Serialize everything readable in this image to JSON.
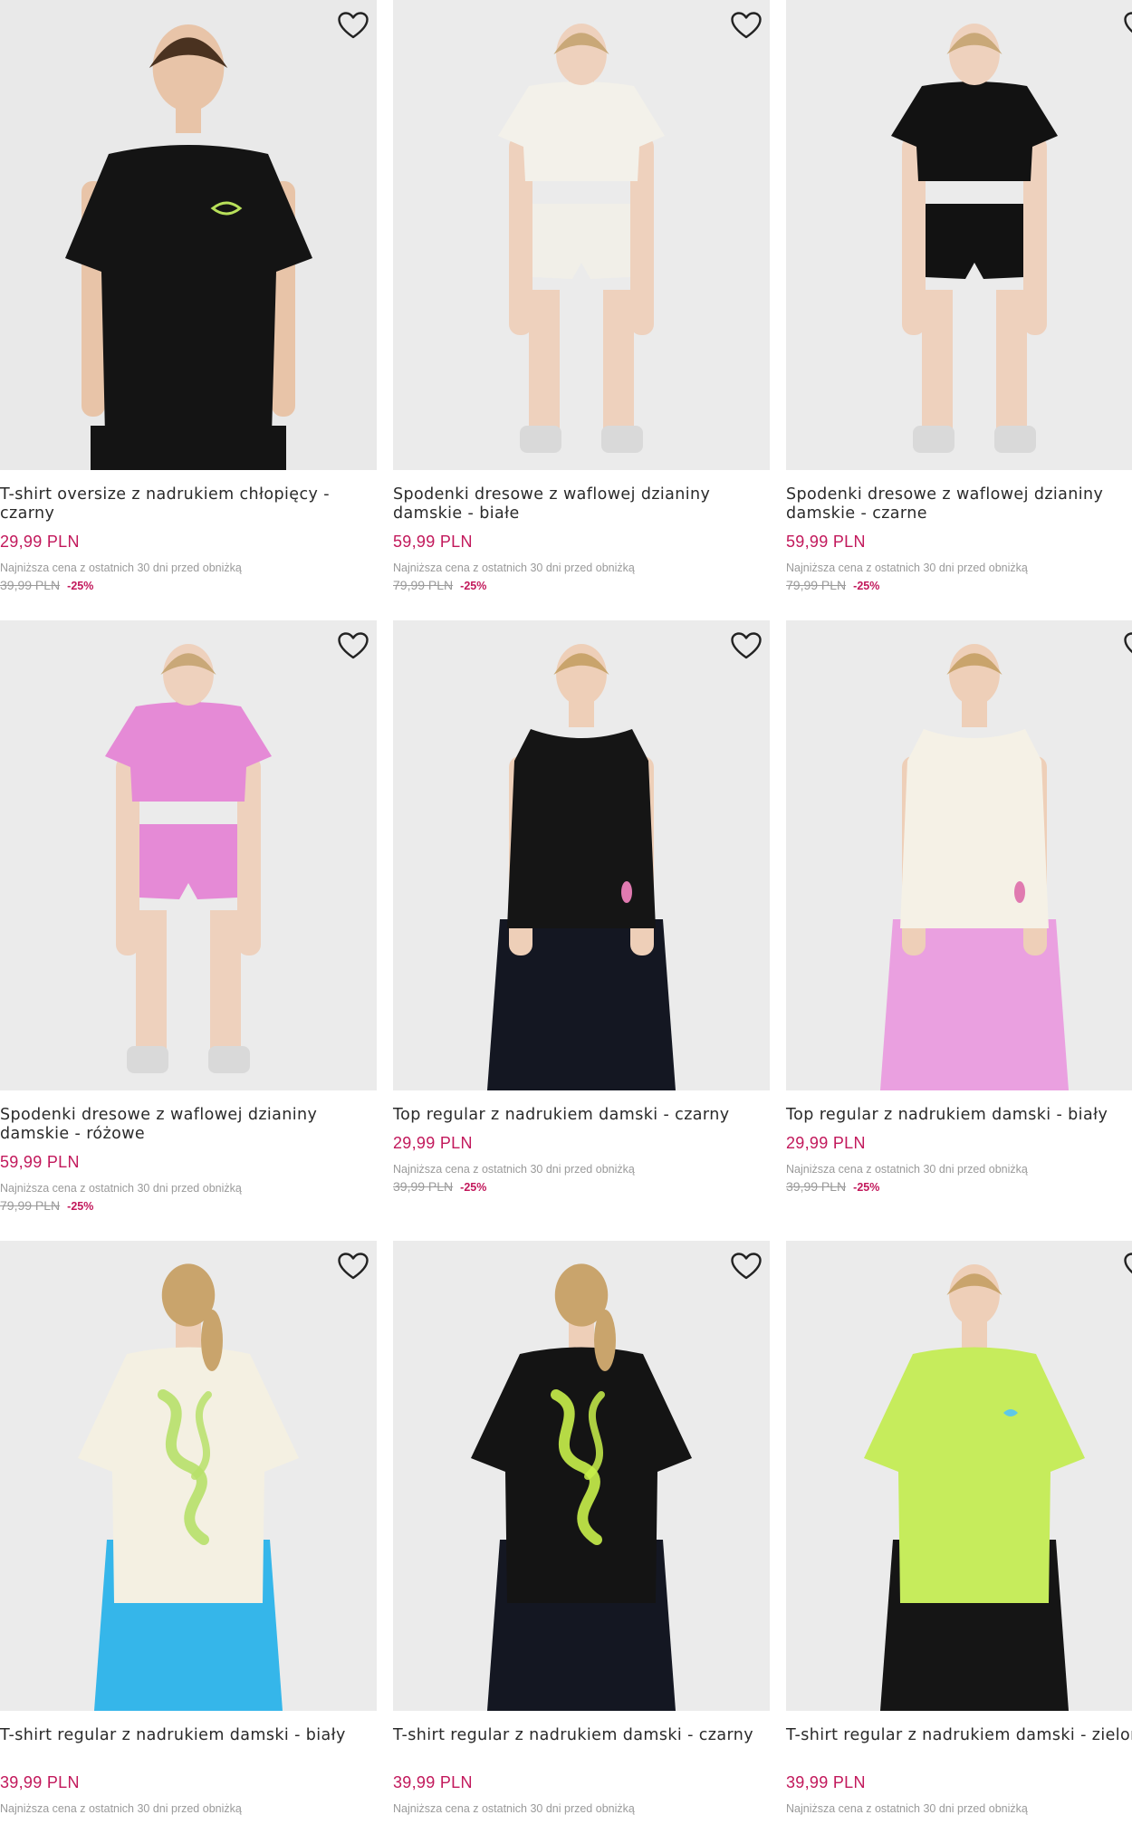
{
  "products": [
    {
      "title": "T-shirt oversize z nadrukiem chłopięcy - czarny",
      "price": "29,99 PLN",
      "lowest_note": "Najniższa cena z ostatnich 30 dni przed obniżką",
      "old_price": "39,99 PLN",
      "discount": "-25%",
      "bg": "#e9e9e9",
      "top": "#141414",
      "bottom": "#141414",
      "skin": "#e8c4a8",
      "hair": "#4a3220",
      "accent": "#b8e05a"
    },
    {
      "title": "Spodenki dresowe z waflowej dzianiny damskie - białe",
      "price": "59,99 PLN",
      "lowest_note": "Najniższa cena z ostatnich 30 dni przed obniżką",
      "old_price": "79,99 PLN",
      "discount": "-25%",
      "bg": "#ebebeb",
      "top": "#f3f1ea",
      "bottom": "#f1efe8",
      "skin": "#eed1bd",
      "hair": "#c9a878",
      "accent": "#7fc8e8"
    },
    {
      "title": "Spodenki dresowe z waflowej dzianiny damskie - czarne",
      "price": "59,99 PLN",
      "lowest_note": "Najniższa cena z ostatnich 30 dni przed obniżką",
      "old_price": "79,99 PLN",
      "discount": "-25%",
      "bg": "#ebebeb",
      "top": "#121212",
      "bottom": "#121212",
      "skin": "#eed1bd",
      "hair": "#c9a878",
      "accent": "#121212"
    },
    {
      "title": "Spodenki dresowe z waflowej dzianiny damskie - różowe",
      "price": "59,99 PLN",
      "lowest_note": "Najniższa cena z ostatnich 30 dni przed obniżką",
      "old_price": "79,99 PLN",
      "discount": "-25%",
      "bg": "#ebebeb",
      "top": "#e58ad6",
      "bottom": "#e58ad6",
      "skin": "#eed1bd",
      "hair": "#c9a878",
      "accent": "#e58ad6"
    },
    {
      "title": "Top regular z nadrukiem damski - czarny",
      "price": "29,99 PLN",
      "lowest_note": "Najniższa cena z ostatnich 30 dni przed obniżką",
      "old_price": "39,99 PLN",
      "discount": "-25%",
      "bg": "#ebebeb",
      "top": "#151515",
      "bottom": "#141722",
      "skin": "#eecfb8",
      "hair": "#c9a46c",
      "accent": "#e07ab0"
    },
    {
      "title": "Top regular z nadrukiem damski - biały",
      "price": "29,99 PLN",
      "lowest_note": "Najniższa cena z ostatnich 30 dni przed obniżką",
      "old_price": "39,99 PLN",
      "discount": "-25%",
      "bg": "#ebebeb",
      "top": "#f5f1e6",
      "bottom": "#eaa0e0",
      "skin": "#eecfb8",
      "hair": "#c9a46c",
      "accent": "#e07ab0"
    },
    {
      "title": "T-shirt regular z nadrukiem damski - biały",
      "price": "39,99 PLN",
      "lowest_note": "Najniższa cena z ostatnich 30 dni przed obniżką",
      "old_price": "",
      "discount": "",
      "bg": "#ebebeb",
      "top": "#f4f0e2",
      "bottom": "#35b6ea",
      "skin": "#eecfb8",
      "hair": "#c9a46c",
      "accent": "#b7e06a"
    },
    {
      "title": "T-shirt regular z nadrukiem damski - czarny",
      "price": "39,99 PLN",
      "lowest_note": "Najniższa cena z ostatnich 30 dni przed obniżką",
      "old_price": "",
      "discount": "",
      "bg": "#ebebeb",
      "top": "#141414",
      "bottom": "#141722",
      "skin": "#eecfb8",
      "hair": "#c9a46c",
      "accent": "#c8f04a"
    },
    {
      "title": "T-shirt regular z nadrukiem damski - zielony",
      "price": "39,99 PLN",
      "lowest_note": "Najniższa cena z ostatnich 30 dni przed obniżką",
      "old_price": "",
      "discount": "",
      "bg": "#ebebeb",
      "top": "#c6ec5c",
      "bottom": "#151515",
      "skin": "#eecfb8",
      "hair": "#c9a46c",
      "accent": "#5ec8e8"
    }
  ],
  "icons": {
    "favorite": "heart-outline-icon"
  },
  "colors": {
    "price": "#c2185b",
    "discount": "#c2185b",
    "muted": "#9a9a9a"
  }
}
